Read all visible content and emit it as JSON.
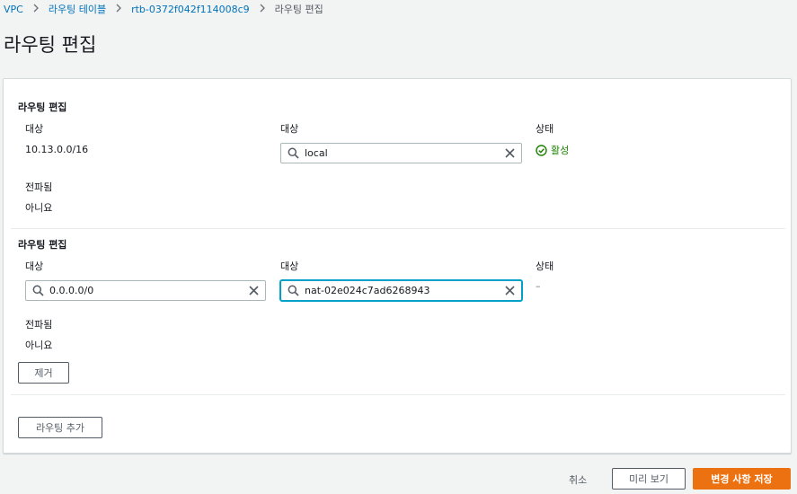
{
  "breadcrumb": {
    "items": [
      "VPC",
      "라우팅 테이블",
      "rtb-0372f042f114008c9"
    ],
    "current": "라우팅 편집"
  },
  "page": {
    "title": "라우팅 편집"
  },
  "routes": [
    {
      "title": "라우팅 편집",
      "destination_label": "대상",
      "destination_value": "10.13.0.0/16",
      "target_label": "대상",
      "target_value": "local",
      "status_label": "상태",
      "status_value": "활성",
      "propagated_label": "전파됨",
      "propagated_value": "아니요"
    },
    {
      "title": "라우팅 편집",
      "destination_label": "대상",
      "destination_value": "0.0.0.0/0",
      "target_label": "대상",
      "target_value": "nat-02e024c7ad6268943",
      "status_label": "상태",
      "status_value": "–",
      "propagated_label": "전파됨",
      "propagated_value": "아니요",
      "remove_label": "제거"
    }
  ],
  "add_route_label": "라우팅 추가",
  "footer": {
    "cancel_label": "취소",
    "preview_label": "미리 보기",
    "save_label": "변경 사항 저장"
  },
  "colors": {
    "link": "#0073bb",
    "status_active": "#1d8102",
    "primary": "#ec7211",
    "focus": "#00a1c9"
  },
  "icons": [
    "chevron-right-icon",
    "search-icon",
    "clear-icon",
    "status-success-icon"
  ]
}
